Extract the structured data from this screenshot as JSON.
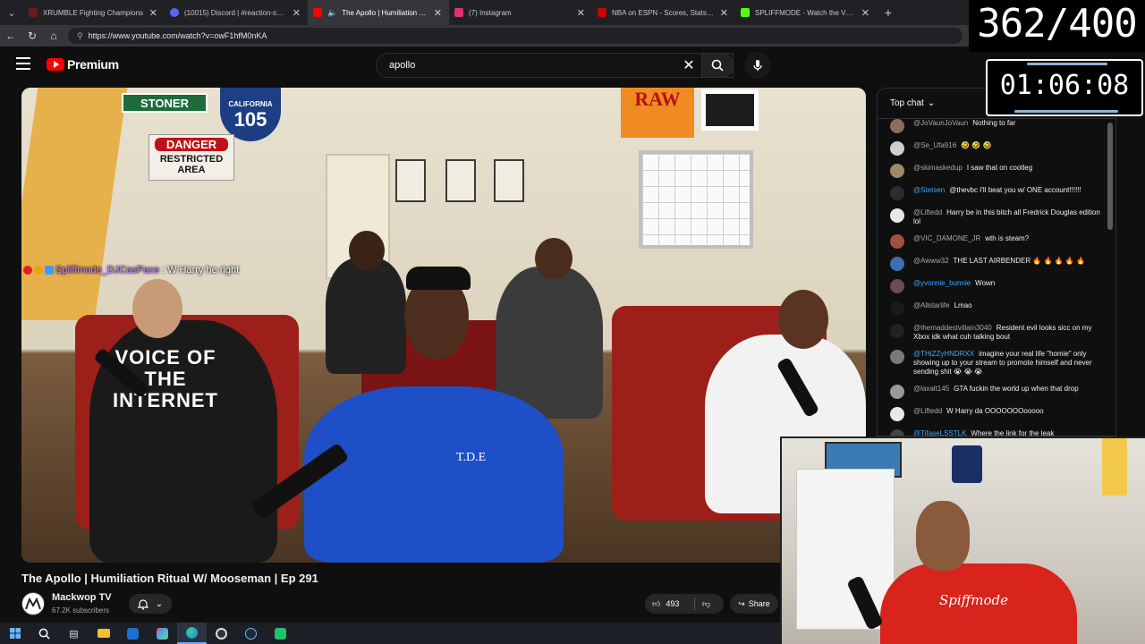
{
  "browser": {
    "tabs": [
      {
        "title": "XRUMBLE Fighting Champions",
        "favicon_color": "#6a1b1b",
        "active": false
      },
      {
        "title": "(10015) Discord | #reaction-subm",
        "favicon_color": "#5865f2",
        "active": false
      },
      {
        "title": "The Apollo | Humiliation Ritual",
        "favicon_color": "#ff0000",
        "active": true
      },
      {
        "title": "(7) Instagram",
        "favicon_color": "#e1306c",
        "active": false
      },
      {
        "title": "NBA on ESPN - Scores, Stats and H",
        "favicon_color": "#cc0000",
        "active": false
      },
      {
        "title": "SPLIFFMODE - Watch the VOD on",
        "favicon_color": "#53fc18",
        "active": false
      }
    ],
    "url": "https://www.youtube.com/watch?v=owF1hfM0nKA"
  },
  "youtube": {
    "brand": "Premium",
    "search_value": "apollo"
  },
  "video": {
    "wall_signs": {
      "stoner": "STONER",
      "ca_state": "CALIFORNIA",
      "ca_number": "105",
      "danger": "DANGER",
      "restricted": "RESTRICTED",
      "area": "AREA",
      "raw": "RAW",
      "shirt": "VOICE OF THE INTERNET",
      "hoodie": "T.D.E"
    },
    "overlay_chat": {
      "user": "Spliffmode_DJCasPace",
      "message": ": W Harry he right"
    },
    "title": "The Apollo | Humiliation Ritual W/ Mooseman | Ep 291",
    "channel": "Mackwop TV",
    "subscribers": "67.2K subscribers",
    "likes": "493",
    "share_label": "Share"
  },
  "chat": {
    "mode": "Top chat",
    "messages": [
      {
        "user": "@JoVaunJoVaun",
        "text": "Nothing to far",
        "member": false,
        "avatar_color": "#8a6d5a"
      },
      {
        "user": "@Se_Ufa916",
        "text": "🤣 🤣 🤣",
        "member": false,
        "avatar_color": "#cfcfcf"
      },
      {
        "user": "@skimaskedup",
        "text": "I saw that on cootleg",
        "member": false,
        "avatar_color": "#9c8a6a"
      },
      {
        "user": "@Stetsen",
        "text": "@thevbc I'll beat you w/ ONE account!!!!!!",
        "member": true,
        "avatar_color": "#2d2d2d"
      },
      {
        "user": "@Liftedd",
        "text": "Harry be in this bitch all Fredrick Douglas edition lol",
        "member": false,
        "avatar_color": "#e8e8e8"
      },
      {
        "user": "@VIC_DAMONE_JR",
        "text": "wth is steam?",
        "member": false,
        "avatar_color": "#a0523d"
      },
      {
        "user": "@Awww32",
        "text": "THE LAST AIRBENDER 🔥 🔥 🔥 🔥 🔥",
        "member": false,
        "avatar_color": "#3b6fb6"
      },
      {
        "user": "@yvonnie_bunnie",
        "text": "Wown",
        "member": true,
        "avatar_color": "#6b4a5a"
      },
      {
        "user": "@Allstarlife",
        "text": "Lmao",
        "member": false,
        "avatar_color": "#1a1a1a"
      },
      {
        "user": "@themaddestvillain3040",
        "text": "Resident evil looks sicc on my Xbox idk what cuh talking bout",
        "member": false,
        "avatar_color": "#222"
      },
      {
        "user": "@THiZZyHNDRXX",
        "text": "imagine your real life \"homie\" only showing up to your stream to promote himself and never sending shit 😭 😭 😭",
        "member": true,
        "avatar_color": "#7a7a7a"
      },
      {
        "user": "@laxalt145",
        "text": "GTA fuckin the world up when that drop",
        "member": false,
        "avatar_color": "#9a9a9a"
      },
      {
        "user": "@Liftedd",
        "text": "W Harry da OOOOOOOooooo",
        "member": false,
        "avatar_color": "#e8e8e8"
      },
      {
        "user": "@TifaseLSSTLK",
        "text": "Where the link for the leak",
        "member": true,
        "avatar_color": "#444"
      }
    ]
  },
  "stream_overlay": {
    "counter": "362/400",
    "timer": "01:06:08"
  },
  "webcam": {
    "shirt_text": "Spiffmode"
  }
}
